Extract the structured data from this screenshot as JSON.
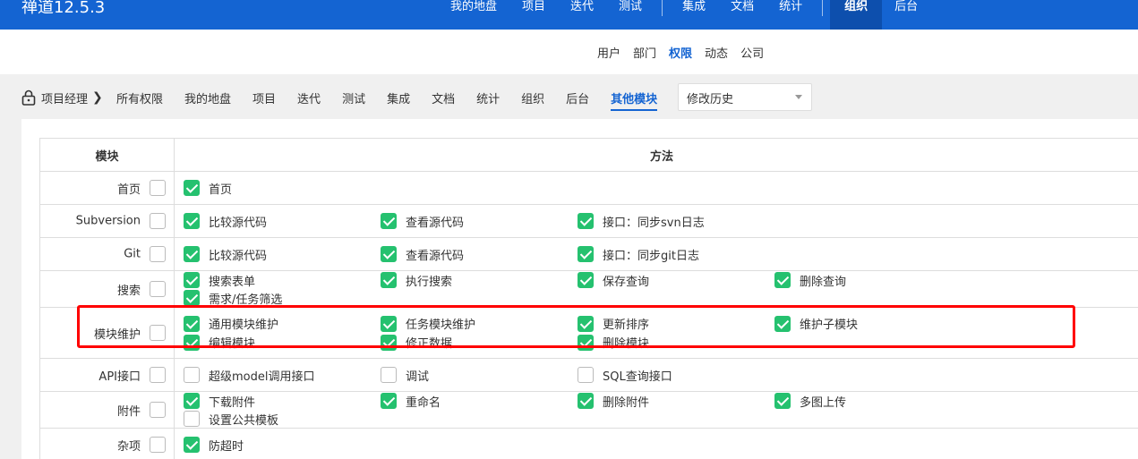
{
  "app": {
    "title": "禅道12.5.3"
  },
  "topnav": {
    "group1": [
      "我的地盘",
      "项目",
      "迭代",
      "测试"
    ],
    "group2": [
      "集成",
      "文档",
      "统计"
    ],
    "group3": [
      "组织",
      "后台"
    ],
    "active": "组织"
  },
  "subnav": {
    "items": [
      "用户",
      "部门",
      "权限",
      "动态",
      "公司"
    ],
    "active": "权限"
  },
  "thirdbar": {
    "crumb": "项目经理",
    "items": [
      "所有权限",
      "我的地盘",
      "项目",
      "迭代",
      "测试",
      "集成",
      "文档",
      "统计",
      "组织",
      "后台",
      "其他模块"
    ],
    "active": "其他模块",
    "select_value": "修改历史"
  },
  "table": {
    "headers": {
      "module": "模块",
      "method": "方法"
    },
    "rows": [
      {
        "module": "首页",
        "checked": false,
        "methods": [
          {
            "label": "首页",
            "checked": true
          }
        ]
      },
      {
        "module": "Subversion",
        "checked": false,
        "methods": [
          {
            "label": "比较源代码",
            "checked": true
          },
          {
            "label": "查看源代码",
            "checked": true
          },
          {
            "label": "接口：同步svn日志",
            "checked": true
          }
        ]
      },
      {
        "module": "Git",
        "checked": false,
        "methods": [
          {
            "label": "比较源代码",
            "checked": true
          },
          {
            "label": "查看源代码",
            "checked": true
          },
          {
            "label": "接口：同步git日志",
            "checked": true
          }
        ]
      },
      {
        "module": "搜索",
        "checked": false,
        "methods": [
          {
            "label": "搜索表单",
            "checked": true
          },
          {
            "label": "执行搜索",
            "checked": true
          },
          {
            "label": "保存查询",
            "checked": true
          },
          {
            "label": "删除查询",
            "checked": true
          },
          {
            "label": "需求/任务筛选",
            "checked": true
          }
        ]
      },
      {
        "module": "模块维护",
        "checked": false,
        "methods": [
          {
            "label": "通用模块维护",
            "checked": true
          },
          {
            "label": "任务模块维护",
            "checked": true
          },
          {
            "label": "更新排序",
            "checked": true
          },
          {
            "label": "维护子模块",
            "checked": true
          },
          {
            "label": "编辑模块",
            "checked": true
          },
          {
            "label": "修正数据",
            "checked": true
          },
          {
            "label": "删除模块",
            "checked": true
          }
        ]
      },
      {
        "module": "API接口",
        "checked": false,
        "methods": [
          {
            "label": "超级model调用接口",
            "checked": false
          },
          {
            "label": "调试",
            "checked": false
          },
          {
            "label": "SQL查询接口",
            "checked": false
          }
        ]
      },
      {
        "module": "附件",
        "checked": false,
        "methods": [
          {
            "label": "下载附件",
            "checked": true
          },
          {
            "label": "重命名",
            "checked": true
          },
          {
            "label": "删除附件",
            "checked": true
          },
          {
            "label": "多图上传",
            "checked": true
          },
          {
            "label": "设置公共模板",
            "checked": false
          }
        ]
      },
      {
        "module": "杂项",
        "checked": false,
        "methods": [
          {
            "label": "防超时",
            "checked": true
          }
        ]
      }
    ]
  },
  "colors": {
    "nav_blue": "#1464d2",
    "check_green": "#25c16f",
    "highlight_red": "#ff0000"
  },
  "icons": {
    "lock": "lock-icon",
    "chevron": "chevron-right-icon",
    "caret": "caret-down-icon"
  }
}
